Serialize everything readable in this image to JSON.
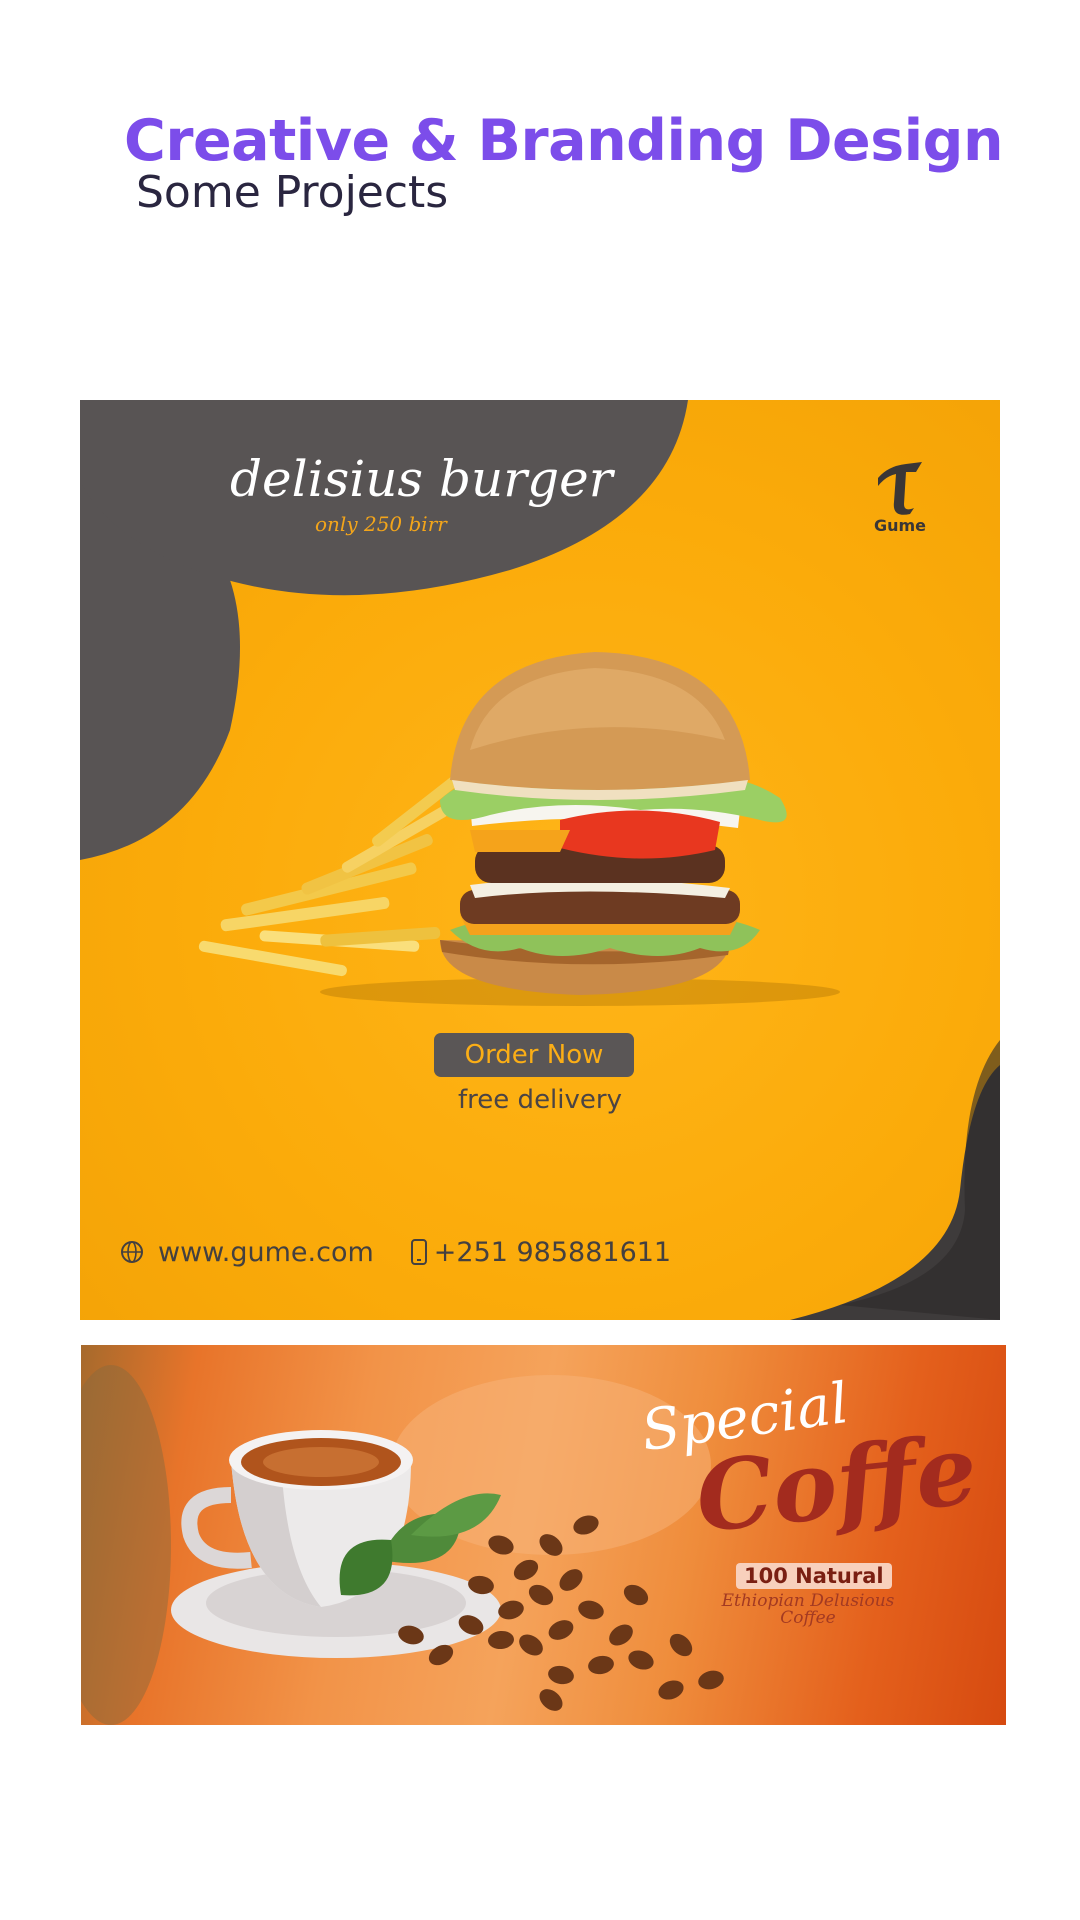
{
  "header": {
    "title": "Creative & Branding Design",
    "subtitle": "Some Projects"
  },
  "burger_poster": {
    "headline": "delisius burger",
    "price": "only 250 birr",
    "brand": "Gume",
    "cta_label": "Order Now",
    "delivery_note": "free delivery",
    "website": "www.gume.com",
    "phone": "+251 985881611",
    "colors": {
      "background": "#fbab0a",
      "dark_shape": "#585454",
      "button": "#5a5656",
      "button_text": "#fbae16"
    },
    "icons": [
      "globe-icon",
      "phone-icon",
      "gume-logo-icon"
    ]
  },
  "coffee_banner": {
    "special": "Special",
    "product": "Coffe",
    "badge": "100 Natural",
    "origin_line1": "Ethiopian Delusious",
    "origin_line2": "Coffee",
    "colors": {
      "background": "#ef8d3c",
      "title": "#a32b1e",
      "badge_bg": "#f8d0bc"
    }
  }
}
